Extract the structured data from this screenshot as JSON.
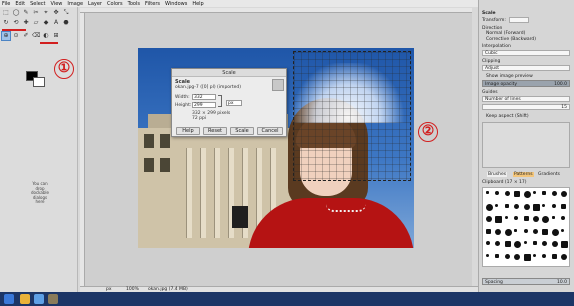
{
  "menubar": [
    "File",
    "Edit",
    "Select",
    "View",
    "Image",
    "Layer",
    "Colors",
    "Tools",
    "Filters",
    "Windows",
    "Help"
  ],
  "toolbox": {
    "marker1": "①",
    "tool_glyphs": [
      "⬚",
      "◯",
      "✎",
      "✂",
      "⌖",
      "✥",
      "⤡",
      "↻",
      "⟲",
      "✚",
      "▱",
      "◆",
      "A",
      "⬣",
      "⊕",
      "⊙",
      "✐",
      "⌫",
      "◐",
      "⊞"
    ],
    "tooltip_text": "You can drop dockable dialogs here"
  },
  "marker2": "②",
  "scale_dialog": {
    "title": "Scale",
    "heading": "Scale",
    "subheading": "okan.jpg-7 ([0] pl) (imported)",
    "width_label": "Width:",
    "width_value": "332",
    "height_label": "Height:",
    "height_value": "299",
    "unit": "px",
    "size_info": "332 × 299 pixels",
    "dpi_info": "72 ppi",
    "buttons": {
      "help": "Help",
      "reset": "Reset",
      "scale": "Scale",
      "cancel": "Cancel"
    }
  },
  "right_panel": {
    "title": "Scale",
    "transform_label": "Transform:",
    "direction_label": "Direction",
    "direction_normal": "Normal (Forward)",
    "direction_corrective": "Corrective (Backward)",
    "interpolation_label": "Interpolation",
    "interpolation_value": "Cubic",
    "clipping_label": "Clipping",
    "clipping_value": "Adjust",
    "show_preview": "Show image preview",
    "opacity_label": "Image opacity",
    "opacity_value": "100.0",
    "guides_label": "Guides",
    "guides_value": "Number of lines",
    "guides_count": "15",
    "keep_aspect": "Keep aspect (Shift)",
    "brush_tabs": [
      "Brushes",
      "Patterns",
      "Gradients"
    ],
    "brush_name": "Clipboard (17 × 17)",
    "spacing_label": "Spacing",
    "spacing_value": "10.0"
  },
  "statusbar": {
    "unit": "px",
    "zoom": "100%",
    "file": "okan.jpg (7.4 MB)"
  },
  "colors": {
    "accent": "#d21f1f",
    "dress": "#b51313",
    "sky": "#1f56a8",
    "taskbar": "#1c3566"
  }
}
